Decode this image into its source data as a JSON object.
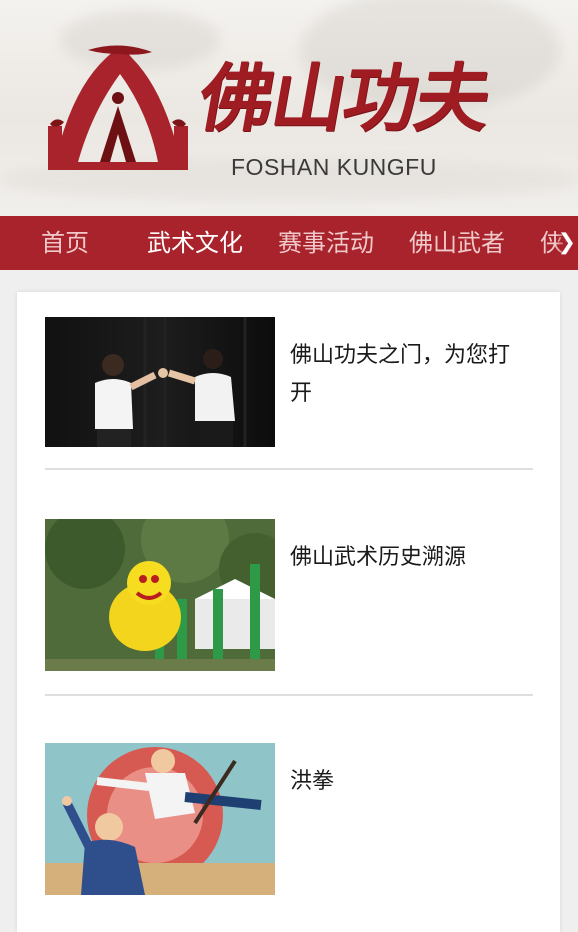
{
  "header": {
    "logo_title": "佛山功夫",
    "logo_subtitle": "FOSHAN KUNGFU",
    "logo_icon": "gate-emblem-icon"
  },
  "colors": {
    "brand_red": "#a8232b",
    "nav_text": "#f0c9cb",
    "nav_active_text": "#ffffff"
  },
  "nav": {
    "items": [
      {
        "label": "首页",
        "active": false
      },
      {
        "label": "武术文化",
        "active": true
      },
      {
        "label": "赛事活动",
        "active": false
      },
      {
        "label": "佛山武者",
        "active": false
      },
      {
        "label": "侠光",
        "active": false
      }
    ],
    "scroll_icon": "chevron-right-icon",
    "scroll_glyph": "❯"
  },
  "articles": [
    {
      "title": "佛山功夫之门，为您打开",
      "image": "kungfu-children-photo"
    },
    {
      "title": "佛山武术历史溯源",
      "image": "lion-dance-photo"
    },
    {
      "title": "洪拳",
      "image": "hung-gar-illustration"
    }
  ]
}
